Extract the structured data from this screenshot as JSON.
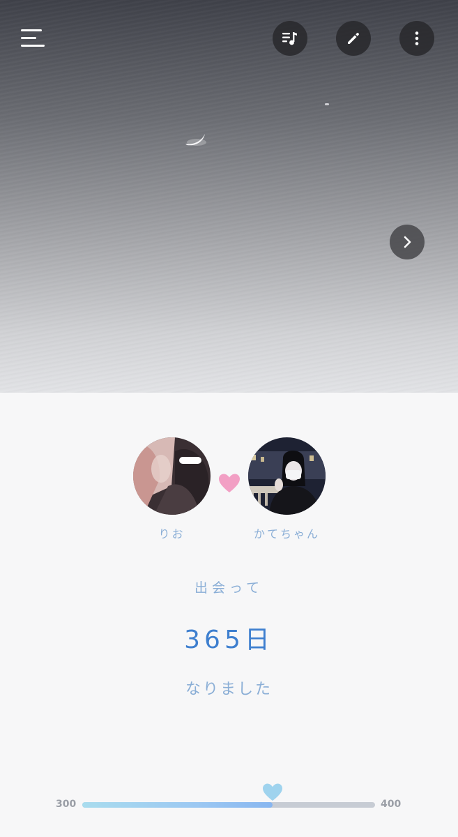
{
  "header": {
    "menu_icon": "hamburger-menu-icon",
    "actions": [
      {
        "icon": "music-playlist-icon"
      },
      {
        "icon": "pencil-icon"
      },
      {
        "icon": "more-vertical-icon"
      }
    ],
    "next_icon": "chevron-right-icon"
  },
  "couple": {
    "left_name": "りお",
    "right_name": "かてちゃん",
    "heart_color": "#f29fc4"
  },
  "counter": {
    "prefix": "出会って",
    "days": "365日",
    "suffix": "なりました"
  },
  "milestone_slider": {
    "min_label": "300",
    "max_label": "400",
    "value": 365,
    "min": 300,
    "max": 400,
    "thumb_icon": "heart-icon"
  },
  "colors": {
    "accent_blue": "#3e7fcf",
    "soft_blue": "#8aaed6",
    "heart_pink": "#f29fc4",
    "thumb_blue": "#9fd3ee"
  }
}
